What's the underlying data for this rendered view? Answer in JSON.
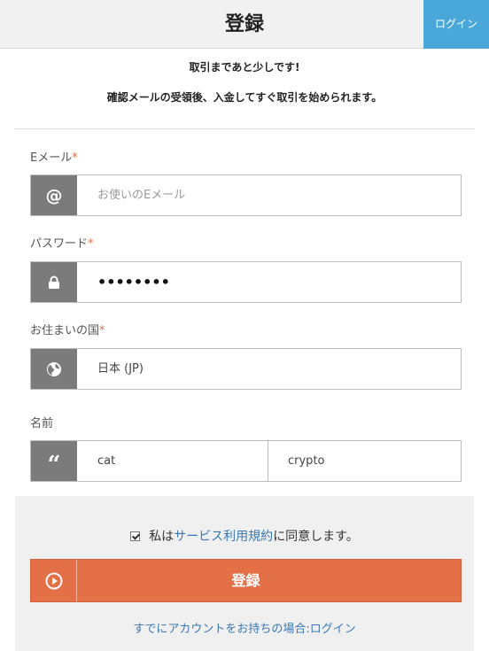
{
  "header": {
    "title": "登録",
    "login_button": "ログイン"
  },
  "intro": {
    "line1": "取引まであと少しです!",
    "line2": "確認メールの受領後、入金してすぐ取引を始められます。"
  },
  "fields": {
    "email": {
      "label": "Eメール",
      "required_mark": "*",
      "placeholder": "お使いのEメール"
    },
    "password": {
      "label": "パスワード",
      "required_mark": "*",
      "value": "••••••••"
    },
    "country": {
      "label": "お住まいの国",
      "required_mark": "*",
      "value": "日本 (JP)"
    },
    "name": {
      "label": "名前",
      "first": "cat",
      "last": "crypto"
    }
  },
  "agreement": {
    "checked": true,
    "prefix": "私は",
    "link": "サービス利用規約",
    "suffix": "に同意します。"
  },
  "submit": {
    "label": "登録"
  },
  "footer": {
    "existing_account": "すでにアカウントをお持ちの場合:ログイン"
  },
  "colors": {
    "accent_blue": "#4aa7d9",
    "submit_orange": "#e47048",
    "link_blue": "#3a78b5",
    "icon_gray": "#7b7b7b"
  },
  "icons": {
    "email": "at-sign-icon",
    "password": "lock-icon",
    "country": "globe-icon",
    "name": "quote-icon",
    "submit": "play-circle-icon"
  }
}
